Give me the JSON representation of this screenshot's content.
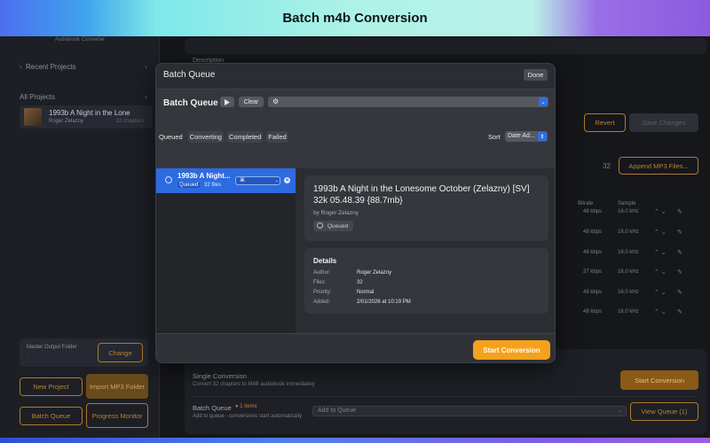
{
  "banner": {
    "title": "Batch  m4b Conversion"
  },
  "sidebar": {
    "app_subtitle": "Audiobook Converter",
    "recent_projects": "Recent Projects",
    "all_projects": "All Projects",
    "project": {
      "title": "1993b  A Night in the Lone",
      "author": "Roger Zelazny",
      "count": "32 chapters"
    },
    "master_output": {
      "label": "Master Output Folder",
      "value": "-",
      "button": "Change"
    },
    "buttons": {
      "new_project": "New Project",
      "import_mp3": "Import MP3 Folder",
      "batch_queue": "Batch Queue",
      "progress_monitor": "Progress Monitor"
    }
  },
  "main": {
    "description_label": "Description",
    "revert": "Revert",
    "save_changes": "Save Changes",
    "count": "32",
    "append_mp3": "Append MP3 Files...",
    "col_bitrate": "Bitrate",
    "col_sample": "Sample",
    "rows": [
      {
        "bitrate": "48 kbps",
        "sample": "16.0 kHz"
      },
      {
        "bitrate": "48 kbps",
        "sample": "16.0 kHz"
      },
      {
        "bitrate": "48 kbps",
        "sample": "16.0 kHz"
      },
      {
        "bitrate": "37 kbps",
        "sample": "16.0 kHz"
      },
      {
        "bitrate": "48 kbps",
        "sample": "16.0 kHz"
      },
      {
        "bitrate": "48 kbps",
        "sample": "16.0 kHz"
      }
    ],
    "single_conversion": {
      "title": "Single Conversion",
      "desc": "Convert 32 chapters to M4B audiobook immediately",
      "button": "Start Conversion"
    },
    "batch_queue": {
      "title": "Batch Queue",
      "badge": "1 items",
      "desc": "Add to queue - conversions start automatically",
      "select": "Add to Queue",
      "button": "View Queue (1)"
    }
  },
  "modal": {
    "title": "Batch Queue",
    "done": "Done",
    "header_title": "Batch Queue",
    "clear": "Clear",
    "tabs": [
      "Queued",
      "Converting",
      "Completed",
      "Failed"
    ],
    "sort_label": "Sort",
    "sort_value": "Date Ad...",
    "queue_item": {
      "title": "1993b   A Night...",
      "status": "Queued",
      "files": "32 files",
      "select_value": "⌘"
    },
    "detail": {
      "title": "1993b   A Night in the Lonesome October (Zelazny) [SV] 32k 05.48.39 {88.7mb}",
      "author": "by Roger Zelazny",
      "status": "Queued",
      "details_heading": "Details",
      "fields": [
        {
          "label": "Author:",
          "value": "Roger Zelazny"
        },
        {
          "label": "Files:",
          "value": "32"
        },
        {
          "label": "Priority:",
          "value": "Normal"
        },
        {
          "label": "Added:",
          "value": "2/01/2026 at 10:19 PM"
        }
      ]
    },
    "start_conversion": "Start Conversion"
  },
  "colors": {
    "accent": "#f5a11b",
    "selection": "#2d6be0"
  }
}
